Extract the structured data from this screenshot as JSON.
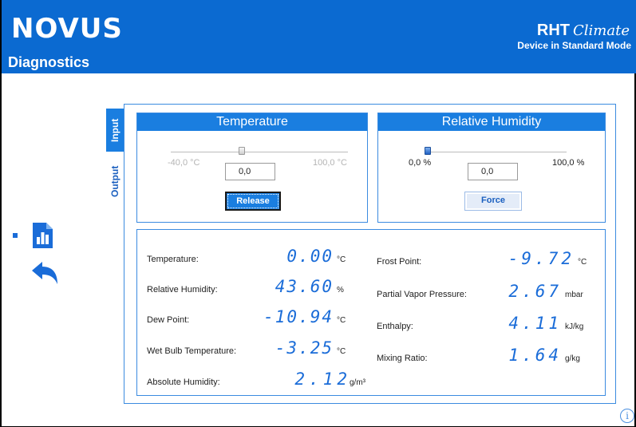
{
  "header": {
    "logo": "NOVUS",
    "page_title": "Diagnostics",
    "product_name": "RHT",
    "product_script": "Climate",
    "device_mode": "Device in Standard Mode"
  },
  "tabs": [
    {
      "label": "Input",
      "active": true
    },
    {
      "label": "Output",
      "active": false
    }
  ],
  "temperature_card": {
    "title": "Temperature",
    "range_min": "-40,0 °C",
    "range_max": "100,0 °C",
    "value": "0,0",
    "slider_fraction": 0.4,
    "button_label": "Release",
    "enabled": false
  },
  "humidity_card": {
    "title": "Relative Humidity",
    "range_min": "0,0 %",
    "range_max": "100,0 %",
    "value": "0,0",
    "slider_fraction": 0.0,
    "button_label": "Force",
    "enabled": true
  },
  "readings_left": [
    {
      "label": "Temperature:",
      "value": "0.00",
      "unit": "°C"
    },
    {
      "label": "Relative Humidity:",
      "value": "43.60",
      "unit": "%"
    },
    {
      "label": "Dew Point:",
      "value": "-10.94",
      "unit": "°C"
    },
    {
      "label": "Wet Bulb Temperature:",
      "value": "-3.25",
      "unit": "°C"
    },
    {
      "label": "Absolute Humidity:",
      "value": "2.12",
      "unit": "g/m³"
    }
  ],
  "readings_right": [
    {
      "label": "Frost Point:",
      "value": "-9.72",
      "unit": "°C"
    },
    {
      "label": "Partial Vapor Pressure:",
      "value": "2.67",
      "unit": "mbar"
    },
    {
      "label": "Enthalpy:",
      "value": "4.11",
      "unit": "kJ/kg"
    },
    {
      "label": "Mixing Ratio:",
      "value": "1.64",
      "unit": "g/kg"
    }
  ],
  "icons": {
    "chart": "bar-chart-document-icon",
    "back": "back-arrow-icon",
    "info": "info-icon"
  },
  "colors": {
    "brand_blue": "#0b6ad1",
    "accent_blue": "#1a7ee0",
    "value_blue": "#1a6cd8"
  }
}
